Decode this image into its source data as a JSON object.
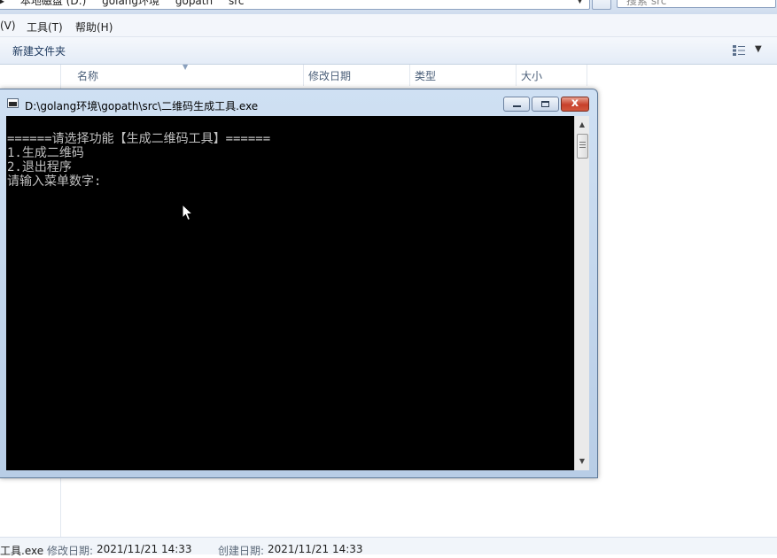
{
  "explorer": {
    "address_crumbs": [
      "本地磁盘 (D:)",
      "golang环境",
      "gopath",
      "src"
    ],
    "search_placeholder": "搜索 src",
    "menu": [
      "(V)",
      "工具(T)",
      "帮助(H)"
    ],
    "toolbar": {
      "new_folder_label": "新建文件夹"
    },
    "columns": [
      "名称",
      "修改日期",
      "类型",
      "大小"
    ],
    "status": {
      "file_name": "工具.exe",
      "modified_label": "修改日期:",
      "modified_value": "2021/11/21 14:33",
      "created_label": "创建日期:",
      "created_value": "2021/11/21 14:33"
    }
  },
  "console": {
    "title": "D:\\golang环境\\gopath\\src\\二维码生成工具.exe",
    "lines": [
      "======请选择功能【生成二维码工具】======",
      "1.生成二维码",
      "2.退出程序",
      "请输入菜单数字:"
    ],
    "close_glyph": "x"
  },
  "colors": {
    "console_bg": "#000000",
    "console_text": "#c0c0c0",
    "close_button": "#c7402b",
    "window_frame": "#b8cde6"
  }
}
